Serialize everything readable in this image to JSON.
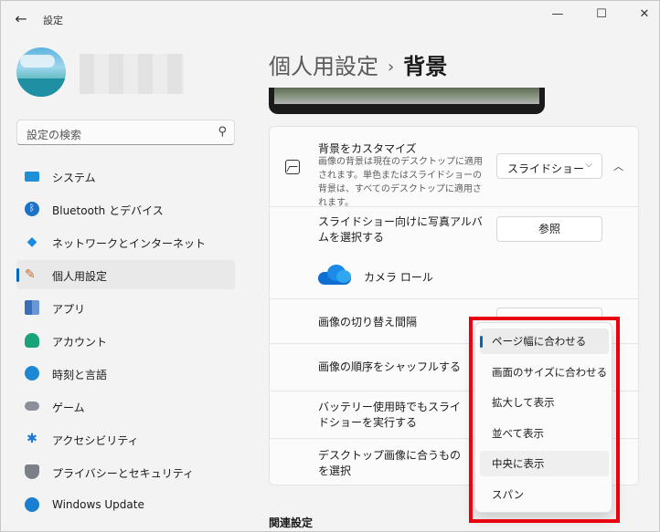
{
  "window": {
    "title": "設定",
    "controls": {
      "minimize": "—",
      "maximize": "☐",
      "close": "✕"
    }
  },
  "sidebar": {
    "search_placeholder": "設定の検索",
    "items": [
      {
        "label": "システム",
        "icon": "system-icon"
      },
      {
        "label": "Bluetooth とデバイス",
        "icon": "bluetooth-icon"
      },
      {
        "label": "ネットワークとインターネット",
        "icon": "wifi-icon"
      },
      {
        "label": "個人用設定",
        "icon": "brush-icon",
        "active": true
      },
      {
        "label": "アプリ",
        "icon": "apps-icon"
      },
      {
        "label": "アカウント",
        "icon": "account-icon"
      },
      {
        "label": "時刻と言語",
        "icon": "clock-icon"
      },
      {
        "label": "ゲーム",
        "icon": "gamepad-icon"
      },
      {
        "label": "アクセシビリティ",
        "icon": "accessibility-icon"
      },
      {
        "label": "プライバシーとセキュリティ",
        "icon": "shield-icon"
      },
      {
        "label": "Windows Update",
        "icon": "update-icon"
      }
    ]
  },
  "breadcrumb": {
    "parent": "個人用設定",
    "separator": "›",
    "current": "背景"
  },
  "panel": {
    "customize": {
      "title": "背景をカスタマイズ",
      "description": "画像の背景は現在のデスクトップに適用されます。単色またはスライドショーの背景は、すべてのデスクトップに適用されます。",
      "selected": "スライドショー"
    },
    "album": {
      "label": "スライドショー向けに写真アルバムを選択する",
      "button": "参照"
    },
    "camera_roll": "カメラ ロール",
    "interval": "画像の切り替え間隔",
    "shuffle": "画像の順序をシャッフルする",
    "battery": "バッテリー使用時でもスライドショーを実行する",
    "fit": "デスクトップ画像に合うものを選択"
  },
  "fit_options": [
    {
      "label": "ページ幅に合わせる",
      "selected": true
    },
    {
      "label": "画面のサイズに合わせる"
    },
    {
      "label": "拡大して表示"
    },
    {
      "label": "並べて表示"
    },
    {
      "label": "中央に表示",
      "hover": true
    },
    {
      "label": "スパン"
    }
  ],
  "related": "関連設定",
  "colors": {
    "accent": "#0067c0",
    "highlight": "#e8000f"
  }
}
